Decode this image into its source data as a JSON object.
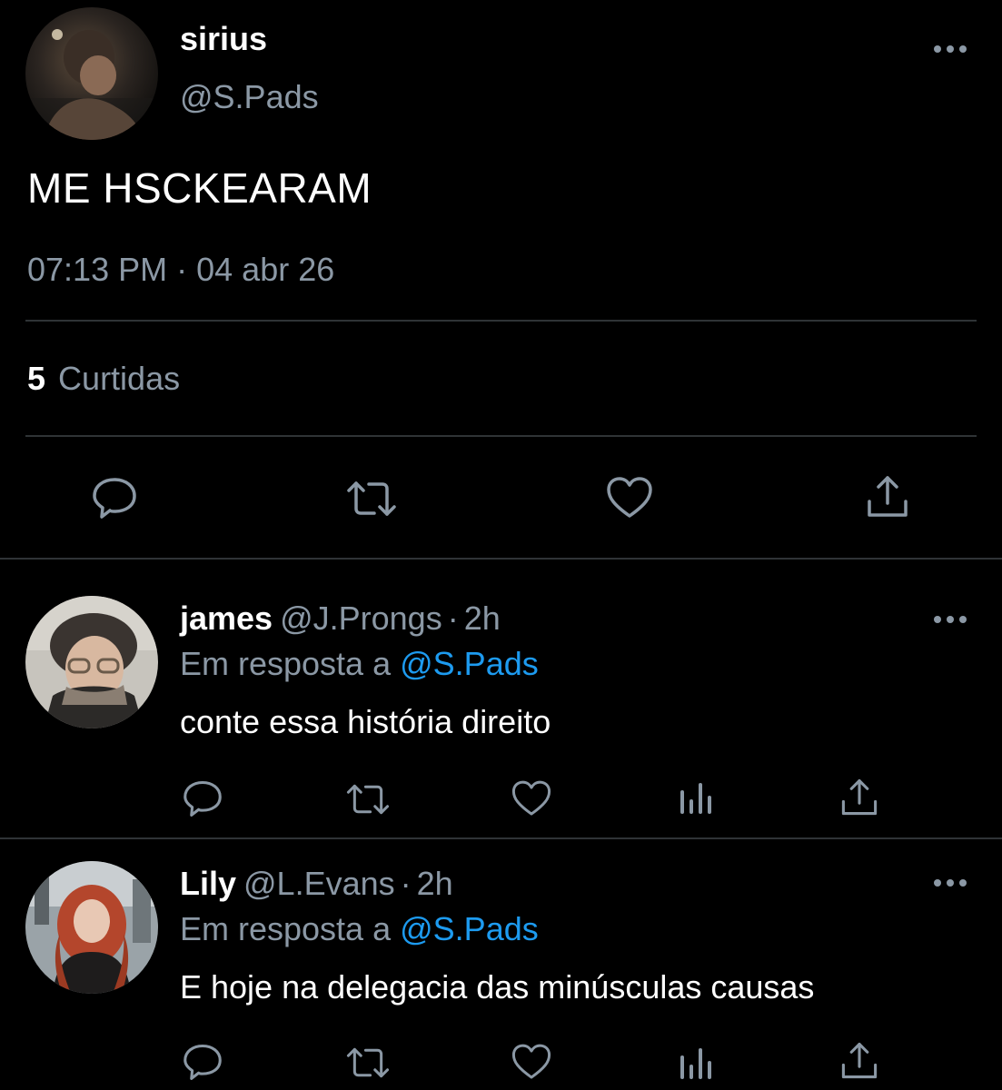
{
  "colors": {
    "background": "#000000",
    "primary_text": "#ffffff",
    "secondary_text": "#8b98a5",
    "link": "#1d9bf0",
    "divider": "#2f3336"
  },
  "main_tweet": {
    "author_name": "sirius",
    "author_handle": "@S.Pads",
    "text": "ME HSCKEARAM",
    "time": "07:13 PM",
    "separator": "·",
    "date": "04 abr 26",
    "likes_count": "5",
    "likes_label": "Curtidas",
    "actions": [
      "reply-icon",
      "retweet-icon",
      "like-icon",
      "share-icon"
    ],
    "more_icon": "more-options-icon"
  },
  "replies": [
    {
      "author_name": "james",
      "author_handle": "@J.Prongs",
      "separator": "·",
      "time": "2h",
      "context_label": "Em resposta a",
      "context_mention": "@S.Pads",
      "text": "conte essa história direito",
      "actions": [
        "reply-icon",
        "retweet-icon",
        "like-icon",
        "analytics-icon",
        "share-icon"
      ]
    },
    {
      "author_name": "Lily",
      "author_handle": "@L.Evans",
      "separator": "·",
      "time": "2h",
      "context_label": "Em resposta a",
      "context_mention": "@S.Pads",
      "text": "E hoje na delegacia das minúsculas causas",
      "actions": [
        "reply-icon",
        "retweet-icon",
        "like-icon",
        "analytics-icon",
        "share-icon"
      ]
    }
  ]
}
